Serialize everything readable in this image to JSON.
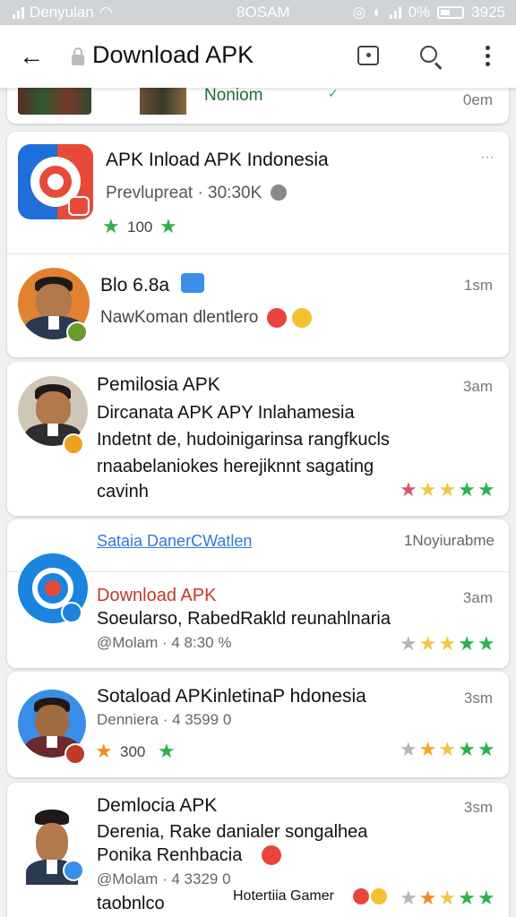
{
  "status_bar": {
    "carrier": "Denyulan",
    "center_time": "8OSAM",
    "battery_pct": "0%",
    "clock": "3925"
  },
  "app_bar": {
    "title": "Download APK"
  },
  "partial_card": {
    "label": "Noniom",
    "time": "0em"
  },
  "card1": {
    "title": "APK Inload APK Indonesia",
    "meta": "Prevlupreat · 30:30K",
    "rating": "100",
    "more": "···",
    "comment_title": "Blo 6.8a",
    "comment_text": "NawKoman dlentlero",
    "comment_time": "1sm"
  },
  "card2": {
    "title": "Pemilosia APK",
    "line1": "Dircanata APK APY Inlahamesia",
    "line2": "Indetnt de, hudoinigarinsa rangfkucls",
    "line3": "rnaabelaniokes herejiknnt sagating",
    "line4": "cavinh",
    "time": "3am",
    "stars": [
      "#d9546b",
      "#f5c542",
      "#f5c542",
      "#2bb24c",
      "#2bb24c"
    ]
  },
  "card3": {
    "link": "Sataia DanerCWatlen",
    "link_right": "1Noyiurabme",
    "title": "Download APK",
    "line1": "Soeularso, RabedRakld reunahlnaria",
    "meta": "@Molam · 4 8:30 %",
    "time": "3am",
    "stars": [
      "#b5b5b5",
      "#f5c542",
      "#f5c542",
      "#2bb24c",
      "#2bb24c"
    ]
  },
  "card4": {
    "title": "Sotaload APKinletinaP hdonesia",
    "meta": "Denniera · 4 3599 0",
    "rating": "300",
    "time": "3sm",
    "stars": [
      "#b5b5b5",
      "#f5a623",
      "#f5c542",
      "#2bb24c",
      "#2bb24c"
    ]
  },
  "card5": {
    "title": "Demlocia APK",
    "line1": "Derenia, Rake danialer songalhea",
    "line2": "Ponika Renhbacia",
    "meta": "@Molam · 4 3329 0",
    "line4": "taobnlco",
    "footer": "Hotertiia Gamer",
    "time": "3sm",
    "stars": [
      "#b5b5b5",
      "#f08a24",
      "#f5c542",
      "#2bb24c",
      "#2bb24c"
    ]
  },
  "colors": {
    "accent_blue": "#1a73e8",
    "link_blue": "#2f7ad6",
    "download_red": "#c0392b",
    "star_green": "#2bb24c"
  }
}
